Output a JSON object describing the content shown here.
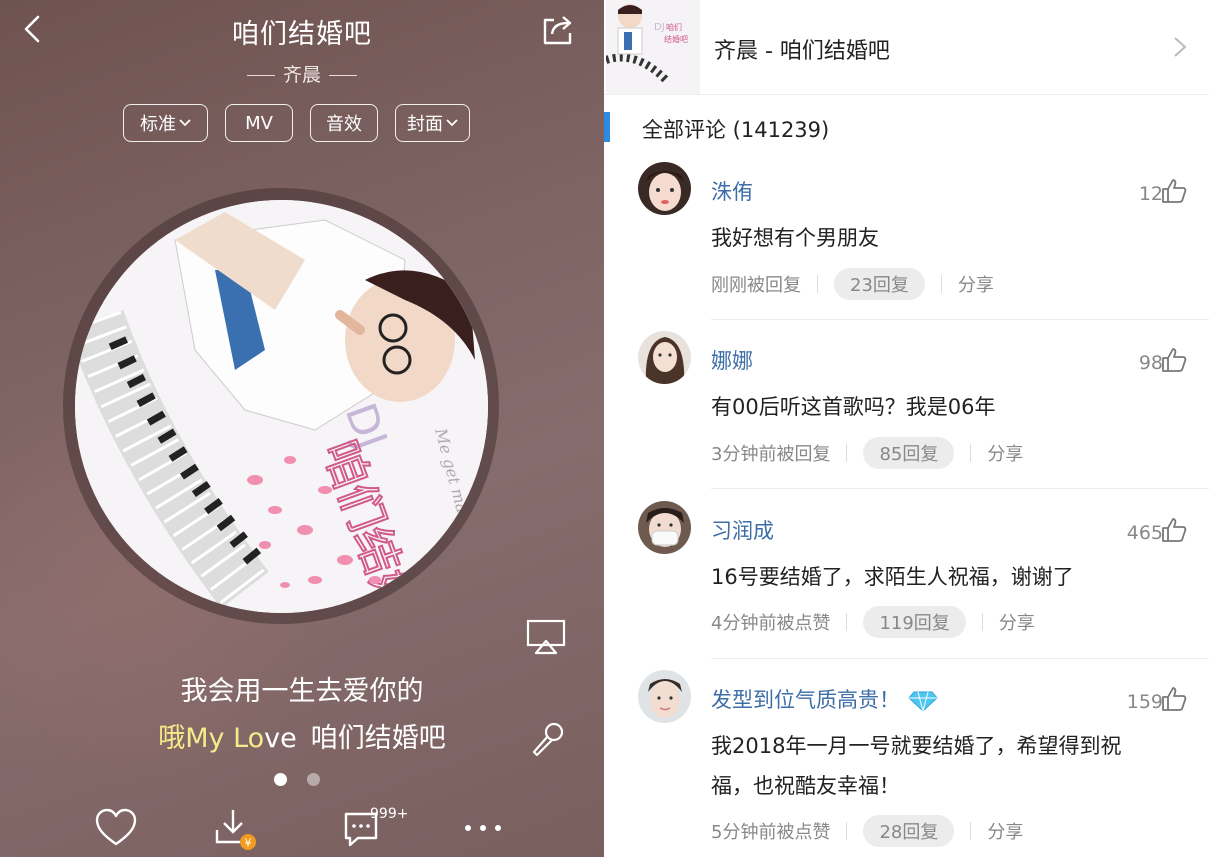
{
  "player": {
    "song_title": "咱们结婚吧",
    "artist": "齐晨",
    "pills": {
      "quality": "标准",
      "mv": "MV",
      "effect": "音效",
      "cover": "封面"
    },
    "lyrics": {
      "line1": "我会用一生去爱你的",
      "line2_highlight": "哦My Lo",
      "line2_rest": "ve",
      "line2_tail": "咱们结婚吧"
    },
    "page_indicator": {
      "count": 2,
      "active": 1
    },
    "comment_count_badge": "999+",
    "cover_art": {
      "label_dj": "DJ",
      "label_title": "咱们结婚吧",
      "signature": "Me get married"
    },
    "colors": {
      "lyric_highlight": "#f6eb8a",
      "background": "#7a5f5f"
    }
  },
  "comments_panel": {
    "header": {
      "title": "齐晨 - 咱们结婚吧"
    },
    "section_title": "全部评论 (141239)",
    "accent_color": "#2a8be0",
    "user_color": "#3e6ea8",
    "items": [
      {
        "user": "洙侑",
        "likes": "12",
        "text": "我好想有个男朋友",
        "time": "刚刚被回复",
        "replies": "23回复",
        "share": "分享"
      },
      {
        "user": "娜娜",
        "likes": "98",
        "text": "有00后听这首歌吗？我是06年",
        "time": "3分钟前被回复",
        "replies": "85回复",
        "share": "分享"
      },
      {
        "user": "习润成",
        "likes": "465",
        "text": "16号要结婚了，求陌生人祝福，谢谢了",
        "time": "4分钟前被点赞",
        "replies": "119回复",
        "share": "分享"
      },
      {
        "user": "发型到位气质高贵！",
        "likes": "159",
        "text_line1": "我2018年一月一号就要结婚了，希望得到祝",
        "text_line2": "福，也祝酷友幸福！",
        "time": "5分钟前被点赞",
        "replies": "28回复",
        "share": "分享",
        "badge_icon": "diamond-vip-icon"
      }
    ]
  }
}
